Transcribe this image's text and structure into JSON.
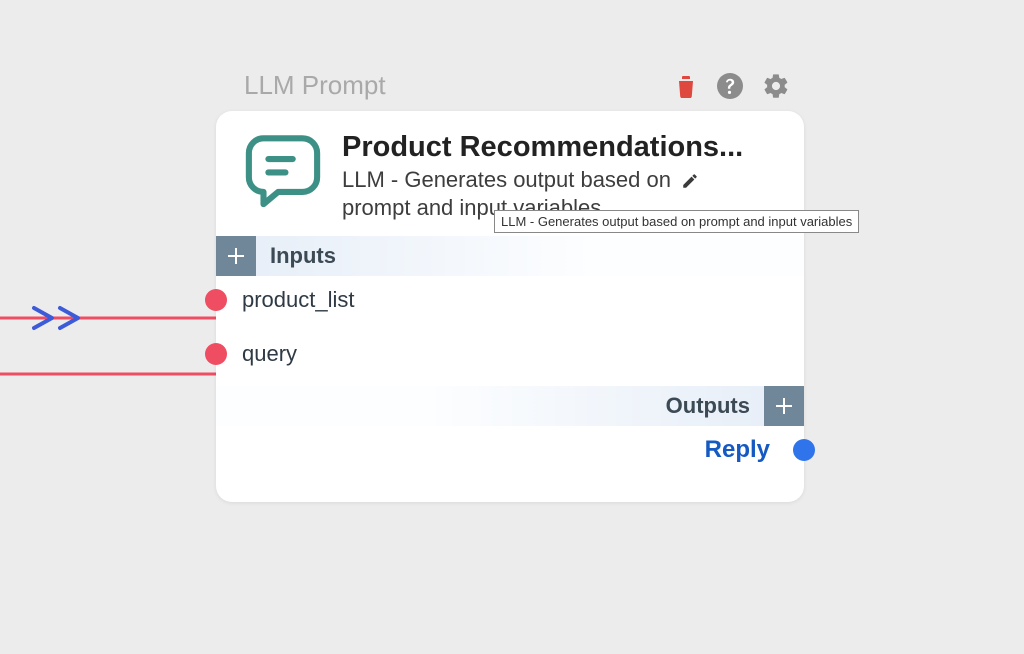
{
  "node": {
    "type_label": "LLM Prompt",
    "title": "Product Recommendations...",
    "description_line1": "LLM - Generates output based on",
    "description_line2": "prompt and input variables",
    "tooltip": "LLM - Generates output based on prompt and input variables",
    "inputs": {
      "section_label": "Inputs",
      "ports": [
        {
          "name": "product_list"
        },
        {
          "name": "query"
        }
      ]
    },
    "outputs": {
      "section_label": "Outputs",
      "ports": [
        {
          "name": "Reply"
        }
      ]
    }
  },
  "colors": {
    "accent_teal": "#3c9085",
    "input_port": "#ef4d62",
    "output_port": "#2f74ea",
    "delete_red": "#de483e",
    "toolbar_grey": "#8c8c8c",
    "plus_bg": "#6f8798"
  }
}
